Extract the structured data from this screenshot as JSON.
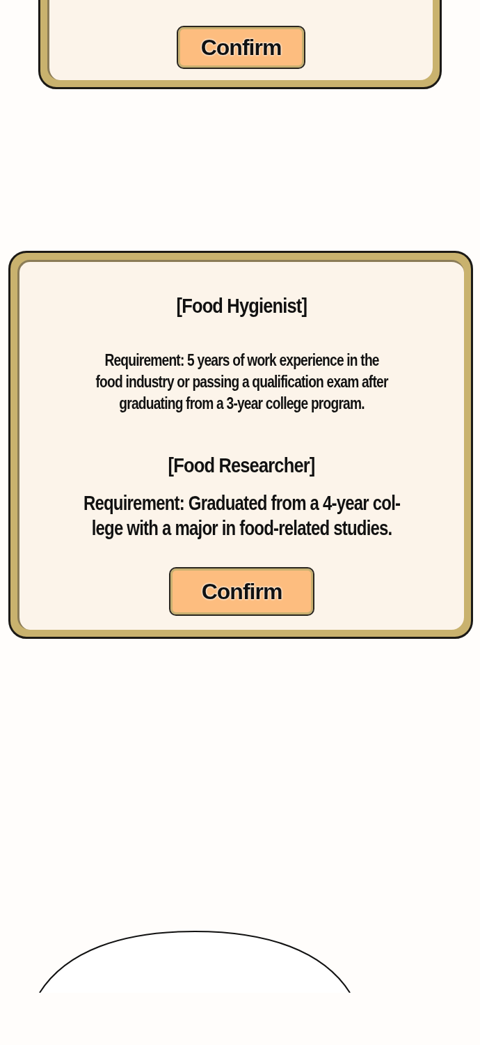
{
  "dialogs": [
    {
      "button": "Confirm"
    },
    {
      "sections": [
        {
          "title": "[Food Hygienist]",
          "text": "Requirement: 5 years of work experience in the\nfood industry or passing a qualification exam after\ngraduating from a 3-year college program."
        },
        {
          "title": "[Food Researcher]",
          "text": "Requirement: Graduated from a 4-year col-\nlege with a major in food-related studies."
        }
      ],
      "button": "Confirm"
    }
  ]
}
